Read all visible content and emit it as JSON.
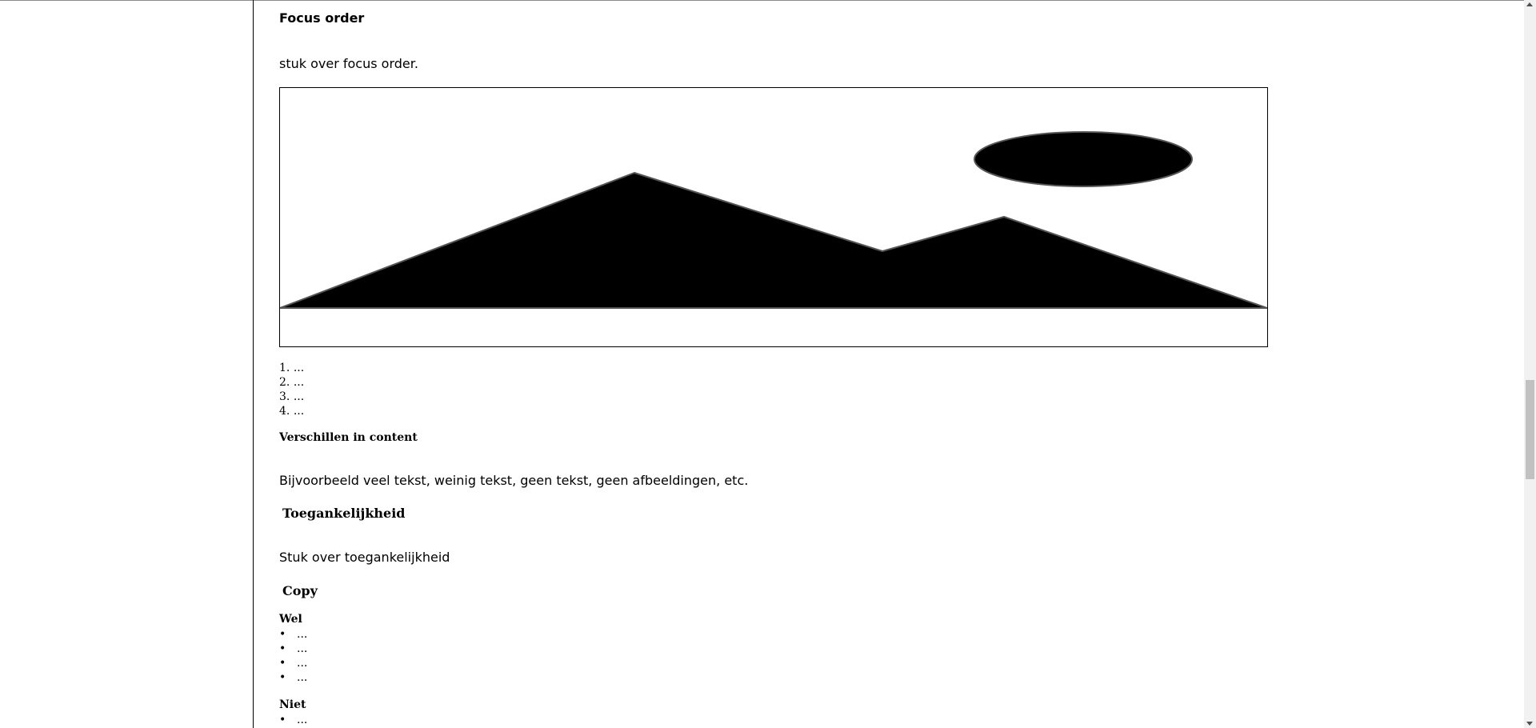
{
  "focus_section": {
    "heading": "Focus order",
    "text": "stuk over focus order.",
    "image_icon": "landscape-placeholder-icon",
    "ordered_items": [
      "...",
      "...",
      "...",
      "..."
    ]
  },
  "content_variations": {
    "heading": "Verschillen in content",
    "text": "Bijvoorbeeld veel tekst, weinig tekst, geen tekst, geen afbeeldingen, etc."
  },
  "accessibility": {
    "heading": "Toegankelijkheid",
    "text": "Stuk over toegankelijkheid"
  },
  "copy": {
    "heading": "Copy",
    "do_heading": "Wel",
    "do_items": [
      "...",
      "...",
      "...",
      "..."
    ],
    "dont_heading": "Niet",
    "dont_items": [
      "..."
    ]
  }
}
